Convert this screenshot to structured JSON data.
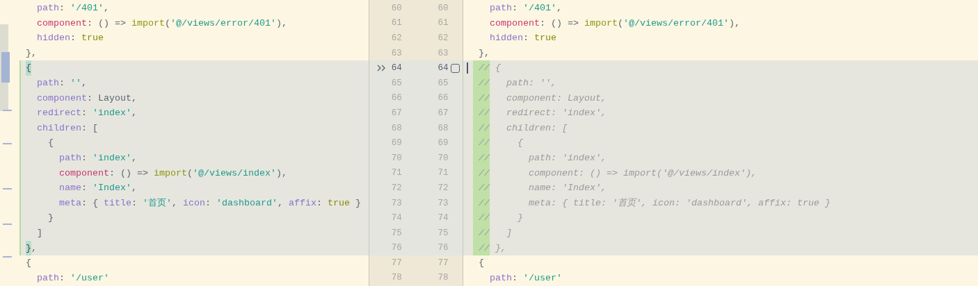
{
  "apply_checkbox": {
    "checked": false
  },
  "rows": [
    {
      "kind": "same",
      "left_number": "60",
      "right_number": "60",
      "left_code": [
        {
          "kind": "key",
          "text": "  path"
        },
        {
          "kind": "punct",
          "text": ": "
        },
        {
          "kind": "string",
          "text": "'/401'"
        },
        {
          "kind": "punct",
          "text": ","
        }
      ],
      "right_code": [
        {
          "kind": "key",
          "text": "  path"
        },
        {
          "kind": "punct",
          "text": ": "
        },
        {
          "kind": "string",
          "text": "'/401'"
        },
        {
          "kind": "punct",
          "text": ","
        }
      ]
    },
    {
      "kind": "same",
      "left_number": "61",
      "right_number": "61",
      "left_code": [
        {
          "kind": "prop",
          "text": "  component"
        },
        {
          "kind": "punct",
          "text": ": () => "
        },
        {
          "kind": "fn",
          "text": "import"
        },
        {
          "kind": "punct",
          "text": "("
        },
        {
          "kind": "string",
          "text": "'@/views/error/401'"
        },
        {
          "kind": "punct",
          "text": "),"
        }
      ],
      "right_code": [
        {
          "kind": "prop",
          "text": "  component"
        },
        {
          "kind": "punct",
          "text": ": () => "
        },
        {
          "kind": "fn",
          "text": "import"
        },
        {
          "kind": "punct",
          "text": "("
        },
        {
          "kind": "string",
          "text": "'@/views/error/401'"
        },
        {
          "kind": "punct",
          "text": "),"
        }
      ]
    },
    {
      "kind": "same",
      "left_number": "62",
      "right_number": "62",
      "left_code": [
        {
          "kind": "key",
          "text": "  hidden"
        },
        {
          "kind": "punct",
          "text": ": "
        },
        {
          "kind": "bool",
          "text": "true"
        }
      ],
      "right_code": [
        {
          "kind": "key",
          "text": "  hidden"
        },
        {
          "kind": "punct",
          "text": ": "
        },
        {
          "kind": "bool",
          "text": "true"
        }
      ]
    },
    {
      "kind": "same",
      "left_number": "63",
      "right_number": "63",
      "left_code": [
        {
          "kind": "punct",
          "text": "},"
        }
      ],
      "right_code": [
        {
          "kind": "punct",
          "text": "},"
        }
      ]
    },
    {
      "kind": "changed-first",
      "left_number": "64",
      "right_number": "64",
      "left_code": [
        {
          "kind": "brace-match",
          "text": "{"
        }
      ],
      "right_code": [
        {
          "kind": "comment-mark",
          "text": "//"
        },
        {
          "kind": "comment",
          "text": " {"
        }
      ]
    },
    {
      "kind": "changed",
      "left_number": "65",
      "right_number": "65",
      "left_code": [
        {
          "kind": "key",
          "text": "  path"
        },
        {
          "kind": "punct",
          "text": ": "
        },
        {
          "kind": "string",
          "text": "''"
        },
        {
          "kind": "punct",
          "text": ","
        }
      ],
      "right_code": [
        {
          "kind": "comment-mark",
          "text": "//"
        },
        {
          "kind": "comment",
          "text": "   path: '',"
        }
      ]
    },
    {
      "kind": "changed",
      "left_number": "66",
      "right_number": "66",
      "left_code": [
        {
          "kind": "key",
          "text": "  component"
        },
        {
          "kind": "punct",
          "text": ": Layout,"
        }
      ],
      "right_code": [
        {
          "kind": "comment-mark",
          "text": "//"
        },
        {
          "kind": "comment",
          "text": "   component: Layout,"
        }
      ]
    },
    {
      "kind": "changed",
      "left_number": "67",
      "right_number": "67",
      "left_code": [
        {
          "kind": "key",
          "text": "  redirect"
        },
        {
          "kind": "punct",
          "text": ": "
        },
        {
          "kind": "string",
          "text": "'index'"
        },
        {
          "kind": "punct",
          "text": ","
        }
      ],
      "right_code": [
        {
          "kind": "comment-mark",
          "text": "//"
        },
        {
          "kind": "comment",
          "text": "   redirect: 'index',"
        }
      ]
    },
    {
      "kind": "changed",
      "left_number": "68",
      "right_number": "68",
      "left_code": [
        {
          "kind": "key",
          "text": "  children"
        },
        {
          "kind": "punct",
          "text": ": ["
        }
      ],
      "right_code": [
        {
          "kind": "comment-mark",
          "text": "//"
        },
        {
          "kind": "comment",
          "text": "   children: ["
        }
      ]
    },
    {
      "kind": "changed",
      "left_number": "69",
      "right_number": "69",
      "left_code": [
        {
          "kind": "punct",
          "text": "    {"
        }
      ],
      "right_code": [
        {
          "kind": "comment-mark",
          "text": "//"
        },
        {
          "kind": "comment",
          "text": "     {"
        }
      ]
    },
    {
      "kind": "changed",
      "left_number": "70",
      "right_number": "70",
      "left_code": [
        {
          "kind": "key",
          "text": "      path"
        },
        {
          "kind": "punct",
          "text": ": "
        },
        {
          "kind": "string",
          "text": "'index'"
        },
        {
          "kind": "punct",
          "text": ","
        }
      ],
      "right_code": [
        {
          "kind": "comment-mark",
          "text": "//"
        },
        {
          "kind": "comment",
          "text": "       path: 'index',"
        }
      ]
    },
    {
      "kind": "changed",
      "left_number": "71",
      "right_number": "71",
      "left_code": [
        {
          "kind": "prop",
          "text": "      component"
        },
        {
          "kind": "punct",
          "text": ": () => "
        },
        {
          "kind": "fn",
          "text": "import"
        },
        {
          "kind": "punct",
          "text": "("
        },
        {
          "kind": "string",
          "text": "'@/views/index'"
        },
        {
          "kind": "punct",
          "text": "),"
        }
      ],
      "right_code": [
        {
          "kind": "comment-mark",
          "text": "//"
        },
        {
          "kind": "comment",
          "text": "       component: () => import('@/views/index'),"
        }
      ]
    },
    {
      "kind": "changed",
      "left_number": "72",
      "right_number": "72",
      "left_code": [
        {
          "kind": "key",
          "text": "      name"
        },
        {
          "kind": "punct",
          "text": ": "
        },
        {
          "kind": "string",
          "text": "'Index'"
        },
        {
          "kind": "punct",
          "text": ","
        }
      ],
      "right_code": [
        {
          "kind": "comment-mark",
          "text": "//"
        },
        {
          "kind": "comment",
          "text": "       name: 'Index',"
        }
      ]
    },
    {
      "kind": "changed",
      "left_number": "73",
      "right_number": "73",
      "left_code": [
        {
          "kind": "key",
          "text": "      meta"
        },
        {
          "kind": "punct",
          "text": ": { "
        },
        {
          "kind": "key",
          "text": "title"
        },
        {
          "kind": "punct",
          "text": ": "
        },
        {
          "kind": "string",
          "text": "'首页'"
        },
        {
          "kind": "punct",
          "text": ", "
        },
        {
          "kind": "key",
          "text": "icon"
        },
        {
          "kind": "punct",
          "text": ": "
        },
        {
          "kind": "string",
          "text": "'dashboard'"
        },
        {
          "kind": "punct",
          "text": ", "
        },
        {
          "kind": "key",
          "text": "affix"
        },
        {
          "kind": "punct",
          "text": ": "
        },
        {
          "kind": "bool",
          "text": "true"
        },
        {
          "kind": "punct",
          "text": " }"
        }
      ],
      "right_code": [
        {
          "kind": "comment-mark",
          "text": "//"
        },
        {
          "kind": "comment",
          "text": "       meta: { title: '首页', icon: 'dashboard', affix: true }"
        }
      ]
    },
    {
      "kind": "changed",
      "left_number": "74",
      "right_number": "74",
      "left_code": [
        {
          "kind": "punct",
          "text": "    }"
        }
      ],
      "right_code": [
        {
          "kind": "comment-mark",
          "text": "//"
        },
        {
          "kind": "comment",
          "text": "     }"
        }
      ]
    },
    {
      "kind": "changed",
      "left_number": "75",
      "right_number": "75",
      "left_code": [
        {
          "kind": "punct",
          "text": "  ]"
        }
      ],
      "right_code": [
        {
          "kind": "comment-mark",
          "text": "//"
        },
        {
          "kind": "comment",
          "text": "   ]"
        }
      ]
    },
    {
      "kind": "changed",
      "left_number": "76",
      "right_number": "76",
      "left_code": [
        {
          "kind": "brace-match",
          "text": "}"
        },
        {
          "kind": "punct",
          "text": ","
        }
      ],
      "right_code": [
        {
          "kind": "comment-mark",
          "text": "//"
        },
        {
          "kind": "comment",
          "text": " },"
        }
      ]
    },
    {
      "kind": "same",
      "left_number": "77",
      "right_number": "77",
      "left_code": [
        {
          "kind": "punct",
          "text": "{"
        }
      ],
      "right_code": [
        {
          "kind": "punct",
          "text": "{"
        }
      ]
    },
    {
      "kind": "same",
      "left_number": "78",
      "right_number": "78",
      "left_code": [
        {
          "kind": "key",
          "text": "  path"
        },
        {
          "kind": "punct",
          "text": ": "
        },
        {
          "kind": "string",
          "text": "'/user'"
        }
      ],
      "right_code": [
        {
          "kind": "key",
          "text": "  path"
        },
        {
          "kind": "punct",
          "text": ": "
        },
        {
          "kind": "string",
          "text": "'/user'"
        }
      ]
    }
  ]
}
